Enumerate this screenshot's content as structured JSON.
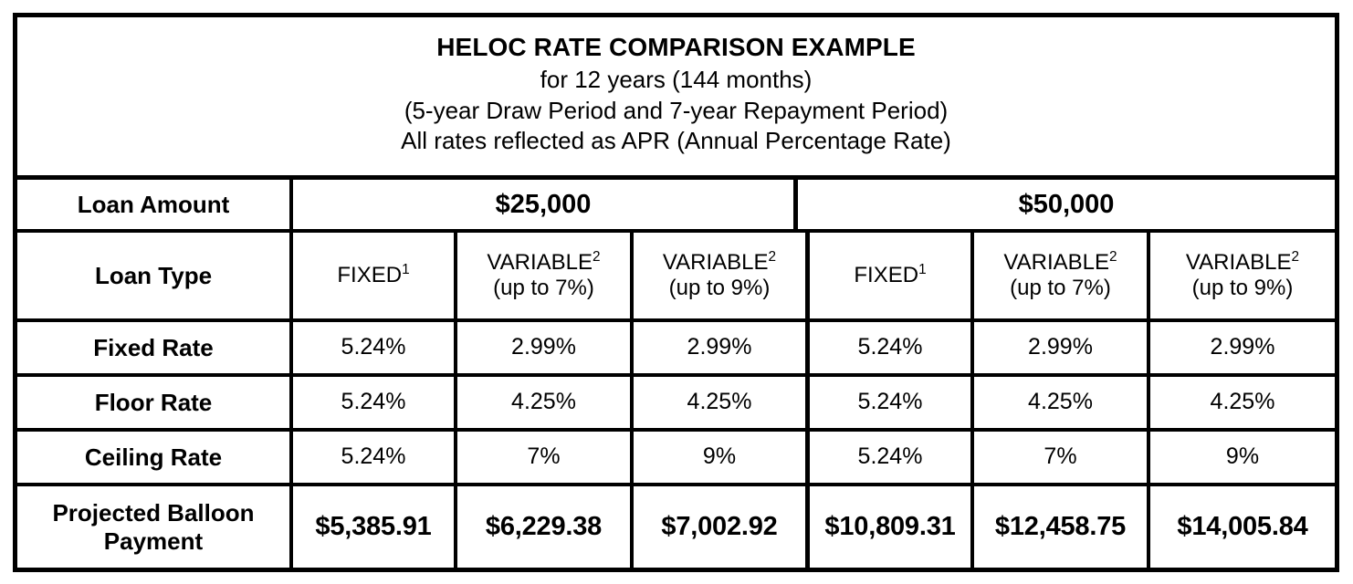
{
  "title": {
    "main": "HELOC RATE COMPARISON EXAMPLE",
    "line2": "for 12 years (144 months)",
    "line3": "(5-year Draw Period and 7-year Repayment Period)",
    "line4": "All rates reflected as APR (Annual Percentage Rate)"
  },
  "colors": {
    "border": "#000000",
    "text": "#000000",
    "background": "#ffffff"
  },
  "table": {
    "row_labels": {
      "loan_amount": "Loan Amount",
      "loan_type": "Loan Type",
      "fixed_rate": "Fixed Rate",
      "floor_rate": "Floor Rate",
      "ceiling_rate": "Ceiling Rate",
      "balloon": "Projected Balloon Payment"
    },
    "loan_amounts": [
      "$25,000",
      "$50,000"
    ],
    "loan_types": [
      {
        "name": "FIXED",
        "sup": "1",
        "qualifier": ""
      },
      {
        "name": "VARIABLE",
        "sup": "2",
        "qualifier": "(up to 7%)"
      },
      {
        "name": "VARIABLE",
        "sup": "2",
        "qualifier": "(up to 9%)"
      },
      {
        "name": "FIXED",
        "sup": "1",
        "qualifier": ""
      },
      {
        "name": "VARIABLE",
        "sup": "2",
        "qualifier": "(up to 7%)"
      },
      {
        "name": "VARIABLE",
        "sup": "2",
        "qualifier": "(up to 9%)"
      }
    ],
    "fixed_rate": [
      "5.24%",
      "2.99%",
      "2.99%",
      "5.24%",
      "2.99%",
      "2.99%"
    ],
    "floor_rate": [
      "5.24%",
      "4.25%",
      "4.25%",
      "5.24%",
      "4.25%",
      "4.25%"
    ],
    "ceiling_rate": [
      "5.24%",
      "7%",
      "9%",
      "5.24%",
      "7%",
      "9%"
    ],
    "balloon_payment": [
      "$5,385.91",
      "$6,229.38",
      "$7,002.92",
      "$10,809.31",
      "$12,458.75",
      "$14,005.84"
    ]
  },
  "chart_data": {
    "type": "table",
    "title": "HELOC RATE COMPARISON EXAMPLE",
    "subtitle": "for 12 years (144 months) / (5-year Draw Period and 7-year Repayment Period) / All rates reflected as APR (Annual Percentage Rate)",
    "row_headers": [
      "Loan Amount",
      "Loan Type",
      "Fixed Rate",
      "Floor Rate",
      "Ceiling Rate",
      "Projected Balloon Payment"
    ],
    "columns": [
      {
        "loan_amount": "$25,000",
        "loan_type": "FIXED¹",
        "fixed_rate": "5.24%",
        "floor_rate": "5.24%",
        "ceiling_rate": "5.24%",
        "balloon_payment": "$5,385.91"
      },
      {
        "loan_amount": "$25,000",
        "loan_type": "VARIABLE² (up to 7%)",
        "fixed_rate": "2.99%",
        "floor_rate": "4.25%",
        "ceiling_rate": "7%",
        "balloon_payment": "$6,229.38"
      },
      {
        "loan_amount": "$25,000",
        "loan_type": "VARIABLE² (up to 9%)",
        "fixed_rate": "2.99%",
        "floor_rate": "4.25%",
        "ceiling_rate": "9%",
        "balloon_payment": "$7,002.92"
      },
      {
        "loan_amount": "$50,000",
        "loan_type": "FIXED¹",
        "fixed_rate": "5.24%",
        "floor_rate": "5.24%",
        "ceiling_rate": "5.24%",
        "balloon_payment": "$10,809.31"
      },
      {
        "loan_amount": "$50,000",
        "loan_type": "VARIABLE² (up to 7%)",
        "fixed_rate": "2.99%",
        "floor_rate": "4.25%",
        "ceiling_rate": "7%",
        "balloon_payment": "$12,458.75"
      },
      {
        "loan_amount": "$50,000",
        "loan_type": "VARIABLE² (up to 9%)",
        "fixed_rate": "2.99%",
        "floor_rate": "4.25%",
        "ceiling_rate": "9%",
        "balloon_payment": "$14,005.84"
      }
    ]
  }
}
